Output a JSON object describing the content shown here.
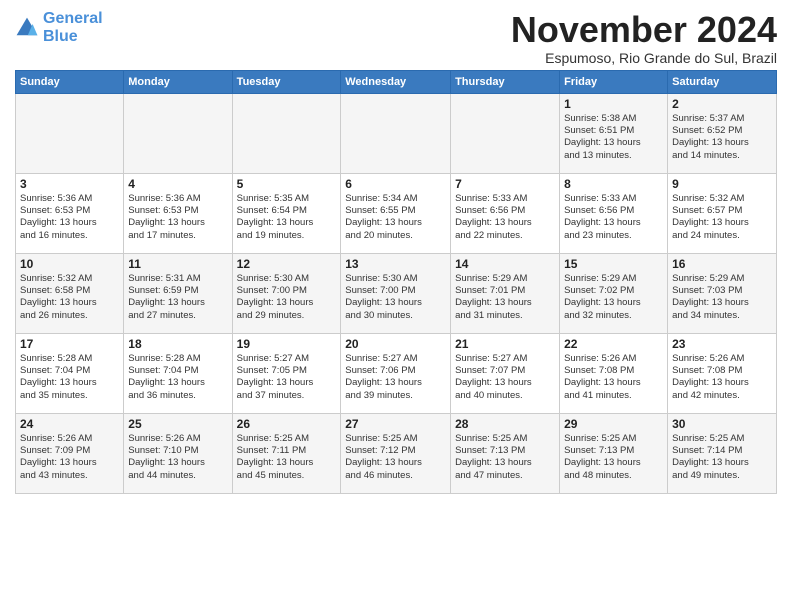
{
  "logo": {
    "line1": "General",
    "line2": "Blue"
  },
  "title": "November 2024",
  "subtitle": "Espumoso, Rio Grande do Sul, Brazil",
  "days_of_week": [
    "Sunday",
    "Monday",
    "Tuesday",
    "Wednesday",
    "Thursday",
    "Friday",
    "Saturday"
  ],
  "weeks": [
    [
      {
        "day": "",
        "info": ""
      },
      {
        "day": "",
        "info": ""
      },
      {
        "day": "",
        "info": ""
      },
      {
        "day": "",
        "info": ""
      },
      {
        "day": "",
        "info": ""
      },
      {
        "day": "1",
        "info": "Sunrise: 5:38 AM\nSunset: 6:51 PM\nDaylight: 13 hours\nand 13 minutes."
      },
      {
        "day": "2",
        "info": "Sunrise: 5:37 AM\nSunset: 6:52 PM\nDaylight: 13 hours\nand 14 minutes."
      }
    ],
    [
      {
        "day": "3",
        "info": "Sunrise: 5:36 AM\nSunset: 6:53 PM\nDaylight: 13 hours\nand 16 minutes."
      },
      {
        "day": "4",
        "info": "Sunrise: 5:36 AM\nSunset: 6:53 PM\nDaylight: 13 hours\nand 17 minutes."
      },
      {
        "day": "5",
        "info": "Sunrise: 5:35 AM\nSunset: 6:54 PM\nDaylight: 13 hours\nand 19 minutes."
      },
      {
        "day": "6",
        "info": "Sunrise: 5:34 AM\nSunset: 6:55 PM\nDaylight: 13 hours\nand 20 minutes."
      },
      {
        "day": "7",
        "info": "Sunrise: 5:33 AM\nSunset: 6:56 PM\nDaylight: 13 hours\nand 22 minutes."
      },
      {
        "day": "8",
        "info": "Sunrise: 5:33 AM\nSunset: 6:56 PM\nDaylight: 13 hours\nand 23 minutes."
      },
      {
        "day": "9",
        "info": "Sunrise: 5:32 AM\nSunset: 6:57 PM\nDaylight: 13 hours\nand 24 minutes."
      }
    ],
    [
      {
        "day": "10",
        "info": "Sunrise: 5:32 AM\nSunset: 6:58 PM\nDaylight: 13 hours\nand 26 minutes."
      },
      {
        "day": "11",
        "info": "Sunrise: 5:31 AM\nSunset: 6:59 PM\nDaylight: 13 hours\nand 27 minutes."
      },
      {
        "day": "12",
        "info": "Sunrise: 5:30 AM\nSunset: 7:00 PM\nDaylight: 13 hours\nand 29 minutes."
      },
      {
        "day": "13",
        "info": "Sunrise: 5:30 AM\nSunset: 7:00 PM\nDaylight: 13 hours\nand 30 minutes."
      },
      {
        "day": "14",
        "info": "Sunrise: 5:29 AM\nSunset: 7:01 PM\nDaylight: 13 hours\nand 31 minutes."
      },
      {
        "day": "15",
        "info": "Sunrise: 5:29 AM\nSunset: 7:02 PM\nDaylight: 13 hours\nand 32 minutes."
      },
      {
        "day": "16",
        "info": "Sunrise: 5:29 AM\nSunset: 7:03 PM\nDaylight: 13 hours\nand 34 minutes."
      }
    ],
    [
      {
        "day": "17",
        "info": "Sunrise: 5:28 AM\nSunset: 7:04 PM\nDaylight: 13 hours\nand 35 minutes."
      },
      {
        "day": "18",
        "info": "Sunrise: 5:28 AM\nSunset: 7:04 PM\nDaylight: 13 hours\nand 36 minutes."
      },
      {
        "day": "19",
        "info": "Sunrise: 5:27 AM\nSunset: 7:05 PM\nDaylight: 13 hours\nand 37 minutes."
      },
      {
        "day": "20",
        "info": "Sunrise: 5:27 AM\nSunset: 7:06 PM\nDaylight: 13 hours\nand 39 minutes."
      },
      {
        "day": "21",
        "info": "Sunrise: 5:27 AM\nSunset: 7:07 PM\nDaylight: 13 hours\nand 40 minutes."
      },
      {
        "day": "22",
        "info": "Sunrise: 5:26 AM\nSunset: 7:08 PM\nDaylight: 13 hours\nand 41 minutes."
      },
      {
        "day": "23",
        "info": "Sunrise: 5:26 AM\nSunset: 7:08 PM\nDaylight: 13 hours\nand 42 minutes."
      }
    ],
    [
      {
        "day": "24",
        "info": "Sunrise: 5:26 AM\nSunset: 7:09 PM\nDaylight: 13 hours\nand 43 minutes."
      },
      {
        "day": "25",
        "info": "Sunrise: 5:26 AM\nSunset: 7:10 PM\nDaylight: 13 hours\nand 44 minutes."
      },
      {
        "day": "26",
        "info": "Sunrise: 5:25 AM\nSunset: 7:11 PM\nDaylight: 13 hours\nand 45 minutes."
      },
      {
        "day": "27",
        "info": "Sunrise: 5:25 AM\nSunset: 7:12 PM\nDaylight: 13 hours\nand 46 minutes."
      },
      {
        "day": "28",
        "info": "Sunrise: 5:25 AM\nSunset: 7:13 PM\nDaylight: 13 hours\nand 47 minutes."
      },
      {
        "day": "29",
        "info": "Sunrise: 5:25 AM\nSunset: 7:13 PM\nDaylight: 13 hours\nand 48 minutes."
      },
      {
        "day": "30",
        "info": "Sunrise: 5:25 AM\nSunset: 7:14 PM\nDaylight: 13 hours\nand 49 minutes."
      }
    ]
  ]
}
